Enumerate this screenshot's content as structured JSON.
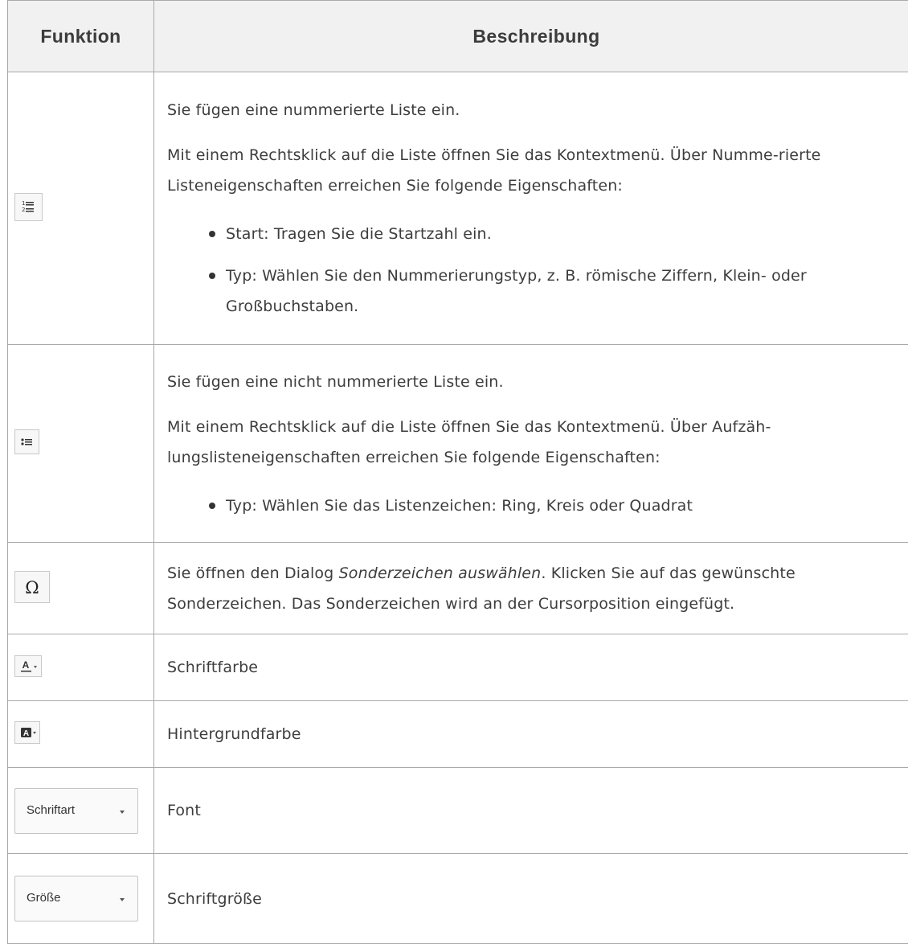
{
  "header": {
    "col_function": "Funktion",
    "col_description": "Beschreibung"
  },
  "rows": [
    {
      "icon": "numbered-list-icon",
      "paragraphs": [
        "Sie fügen eine nummerierte Liste ein.",
        "Mit einem Rechtsklick auf die Liste öffnen Sie das Kontextmenü. Über Numme-rierte Listeneigenschaften erreichen Sie folgende Eigenschaften:"
      ],
      "bullets": [
        "Start: Tragen Sie die Startzahl ein.",
        "Typ: Wählen Sie den Nummerierungstyp, z. B. römische Ziffern, Klein- oder Großbuchstaben."
      ]
    },
    {
      "icon": "bulleted-list-icon",
      "paragraphs": [
        "Sie fügen eine nicht nummerierte Liste ein.",
        "Mit einem Rechtsklick auf die Liste öffnen Sie das Kontextmenü. Über Aufzäh-lungslisteneigenschaften erreichen Sie folgende Eigenschaften:"
      ],
      "bullets": [
        "Typ: Wählen Sie das Listenzeichen: Ring, Kreis oder Quadrat"
      ]
    },
    {
      "icon": "omega-icon",
      "text_before": "Sie öffnen den Dialog ",
      "text_italic": "Sonderzeichen auswählen",
      "text_after": ". Klicken Sie auf das gewünschte Sonderzeichen. Das Sonderzeichen wird an der Cursorposition eingefügt."
    },
    {
      "icon": "font-color-icon",
      "text": "Schriftfarbe"
    },
    {
      "icon": "background-color-icon",
      "text": "Hintergrundfarbe"
    },
    {
      "dropdown_label": "Schriftart",
      "text": "Font"
    },
    {
      "dropdown_label": "Größe",
      "text": "Schriftgröße"
    }
  ]
}
